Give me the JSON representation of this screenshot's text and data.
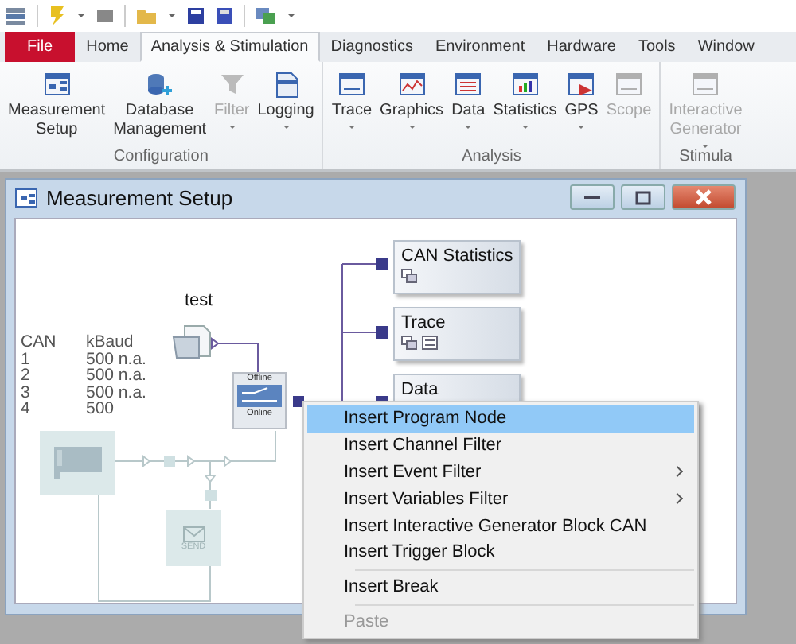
{
  "tabs": [
    {
      "label": "File",
      "kind": "file",
      "selected": false
    },
    {
      "label": "Home",
      "kind": "tab",
      "selected": false
    },
    {
      "label": "Analysis & Stimulation",
      "kind": "tab",
      "selected": true
    },
    {
      "label": "Diagnostics",
      "kind": "tab",
      "selected": false
    },
    {
      "label": "Environment",
      "kind": "tab",
      "selected": false
    },
    {
      "label": "Hardware",
      "kind": "tab",
      "selected": false
    },
    {
      "label": "Tools",
      "kind": "tab",
      "selected": false
    },
    {
      "label": "Window",
      "kind": "tab",
      "selected": false
    }
  ],
  "ribbon_groups": [
    {
      "label": "Configuration",
      "buttons": [
        {
          "label": "Measurement\nSetup",
          "disabled": false,
          "dropdown": false
        },
        {
          "label": "Database\nManagement",
          "disabled": false,
          "dropdown": false
        },
        {
          "label": "Filter",
          "disabled": true,
          "dropdown": true
        },
        {
          "label": "Logging",
          "disabled": false,
          "dropdown": true
        }
      ]
    },
    {
      "label": "Analysis",
      "buttons": [
        {
          "label": "Trace",
          "disabled": false,
          "dropdown": true
        },
        {
          "label": "Graphics",
          "disabled": false,
          "dropdown": true
        },
        {
          "label": "Data",
          "disabled": false,
          "dropdown": true
        },
        {
          "label": "Statistics",
          "disabled": false,
          "dropdown": true
        },
        {
          "label": "GPS",
          "disabled": false,
          "dropdown": true
        },
        {
          "label": "Scope",
          "disabled": true,
          "dropdown": false
        }
      ]
    },
    {
      "label": "Stimula",
      "buttons": [
        {
          "label": "Interactive\nGenerator",
          "disabled": true,
          "dropdown": true
        }
      ]
    }
  ],
  "window": {
    "title": "Measurement Setup"
  },
  "can_table": {
    "columns": [
      "CAN",
      "kBaud"
    ],
    "rows": [
      [
        "1",
        "500 n.a."
      ],
      [
        "2",
        "500 n.a."
      ],
      [
        "3",
        "500 n.a."
      ],
      [
        "4",
        "500"
      ]
    ]
  },
  "log_node": {
    "label": "test"
  },
  "switch_node": {
    "top_label": "Offline",
    "bottom_label": "Online",
    "online": false
  },
  "send_node": {
    "label": "SEND"
  },
  "analysis_blocks": [
    {
      "label": "CAN Statistics"
    },
    {
      "label": "Trace"
    },
    {
      "label": "Data"
    }
  ],
  "context_menu": [
    {
      "kind": "item",
      "label": "Insert Program Node",
      "selected": true,
      "disabled": false,
      "submenu": false
    },
    {
      "kind": "item",
      "label": "Insert Channel Filter",
      "selected": false,
      "disabled": false,
      "submenu": false
    },
    {
      "kind": "item",
      "label": "Insert Event Filter",
      "selected": false,
      "disabled": false,
      "submenu": true
    },
    {
      "kind": "item",
      "label": "Insert Variables Filter",
      "selected": false,
      "disabled": false,
      "submenu": true
    },
    {
      "kind": "item",
      "label": "Insert Interactive Generator Block CAN",
      "selected": false,
      "disabled": false,
      "submenu": false
    },
    {
      "kind": "item",
      "label": "Insert Trigger Block",
      "selected": false,
      "disabled": false,
      "submenu": false
    },
    {
      "kind": "separator"
    },
    {
      "kind": "item",
      "label": "Insert Break",
      "selected": false,
      "disabled": false,
      "submenu": false
    },
    {
      "kind": "separator"
    },
    {
      "kind": "item",
      "label": "Paste",
      "selected": false,
      "disabled": true,
      "submenu": false
    }
  ]
}
